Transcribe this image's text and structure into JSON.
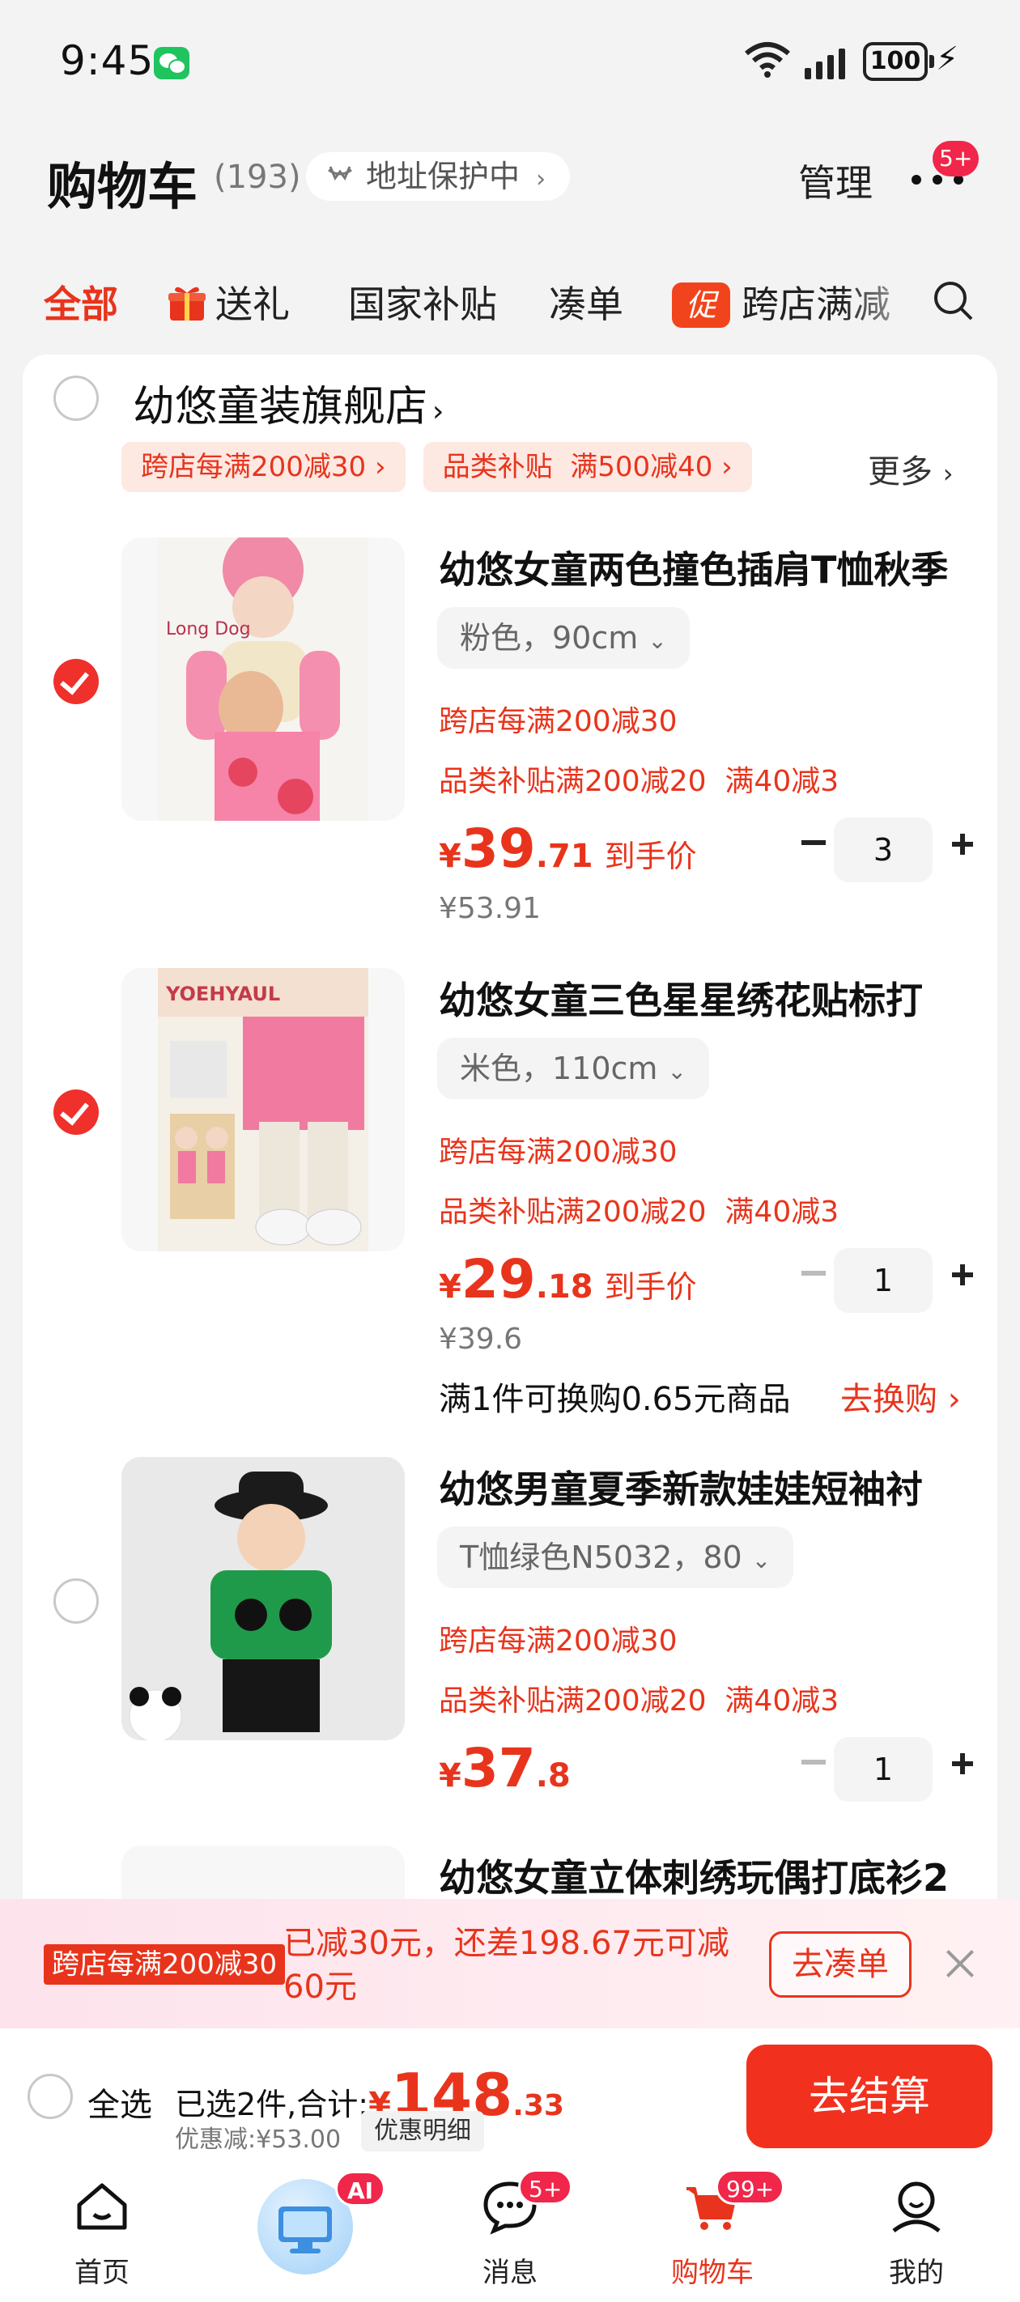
{
  "status": {
    "time": "9:45",
    "battery": "100"
  },
  "header": {
    "title": "购物车",
    "count": "(193)",
    "address_protect": "地址保护中",
    "manage": "管理",
    "more_badge": "5+"
  },
  "tabs": [
    "全部",
    "送礼",
    "国家补贴",
    "凑单",
    "跨店满减"
  ],
  "tab_promo_icon": "促",
  "store": {
    "name": "幼悠童装旗舰店",
    "chips": [
      "跨店每满200减30",
      "品类补贴  满500减40"
    ],
    "more": "更多"
  },
  "items": [
    {
      "title": "幼悠女童两色撞色插肩T恤秋季",
      "sku": "粉色，90cm",
      "promo1": "跨店每满200减30",
      "promo2": "品类补贴满200减20  满40减3",
      "price_cur": "¥",
      "price_int": "39",
      "price_dec": ".71",
      "price_after": "到手价",
      "orig": "¥53.91",
      "qty": "3",
      "checked": true
    },
    {
      "title": "幼悠女童三色星星绣花贴标打",
      "sku": "米色，110cm",
      "promo1": "跨店每满200减30",
      "promo2": "品类补贴满200减20  满40减3",
      "price_cur": "¥",
      "price_int": "29",
      "price_dec": ".18",
      "price_after": "到手价",
      "orig": "¥39.6",
      "qty": "1",
      "checked": true,
      "swap": "满1件可换购0.65元商品",
      "swap_link": "去换购"
    },
    {
      "title": "幼悠男童夏季新款娃娃短袖衬",
      "sku": "T恤绿色N5032，80",
      "promo1": "跨店每满200减30",
      "promo2": "品类补贴满200减20  满40减3",
      "price_cur": "¥",
      "price_int": "37",
      "price_dec": ".8",
      "qty": "1",
      "checked": false
    },
    {
      "title": "幼悠女童立体刺绣玩偶打底衫2"
    }
  ],
  "banner": {
    "tag": "跨店每满200减30",
    "text": "已减30元，还差198.67元可减60元",
    "button": "去凑单"
  },
  "checkout": {
    "select_all": "全选",
    "selected": "已选2件,合计:",
    "total_cur": "¥",
    "total_int": "148",
    "total_dec": ".33",
    "discount": "优惠减:¥53.00",
    "discount_detail": "优惠明细",
    "pay": "去结算"
  },
  "tabbar": {
    "items": [
      "首页",
      "消息",
      "购物车",
      "我的"
    ],
    "ai_badge": "AI",
    "msg_badge": "5+",
    "cart_badge": "99+"
  }
}
